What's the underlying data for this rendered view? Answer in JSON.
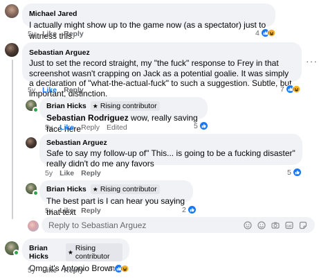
{
  "comments": [
    {
      "author": "Michael Jared",
      "text": "I actually might show up to the game now (as a spectator) just to witness this.",
      "time": "5y",
      "like": "Like",
      "reply": "Reply",
      "reactions": "4"
    },
    {
      "author": "Sebastian Arguez",
      "text": "Just to set the record straight, my \"the fuck\" response to Frey in that screenshot wasn't crapping on Jack as a potential goalie. It was simply a declaration of \"what-the-actual-fuck\" to such a suggestion. Subtle, but important, distinction.",
      "time": "5y",
      "like": "Like",
      "reply": "Reply",
      "reactions": "7"
    }
  ],
  "replies": [
    {
      "author": "Brian Hicks",
      "badge": "Rising contributor",
      "tag": "Sebastian Rodriguez",
      "text": " wow, really saving face here",
      "time": "5y",
      "like": "Like",
      "reply": "Reply",
      "edited": "Edited",
      "reactions": "5"
    },
    {
      "author": "Sebastian Arguez",
      "text": "Safe to say my follow-up of\" This... is going to be a fucking disaster\" really didn't do me any favors",
      "time": "5y",
      "like": "Like",
      "reply": "Reply",
      "reactions": "5"
    },
    {
      "author": "Brian Hicks",
      "badge": "Rising contributor",
      "text": "The best part is I can hear you saying that text",
      "time": "5y",
      "like": "Like",
      "reply": "Reply",
      "reactions": "2"
    }
  ],
  "reply_box": {
    "placeholder": "Reply to Sebastian Arguez"
  },
  "last_comment": {
    "author": "Brian Hicks",
    "badge": "Rising contributor",
    "text": "Omg it's Antonio Brown!",
    "time": "5y",
    "like": "Like",
    "reply": "Reply",
    "reactions": "5"
  },
  "colors": {
    "like_blue": "#1877f2",
    "bubble": "#f0f2f5",
    "meta": "#65676b",
    "online": "#31a24c"
  },
  "icons": [
    "like-icon",
    "haha-icon",
    "more-icon",
    "sticker-icon",
    "emoji-icon",
    "camera-icon",
    "gif-icon",
    "avatar-sticker-icon"
  ]
}
